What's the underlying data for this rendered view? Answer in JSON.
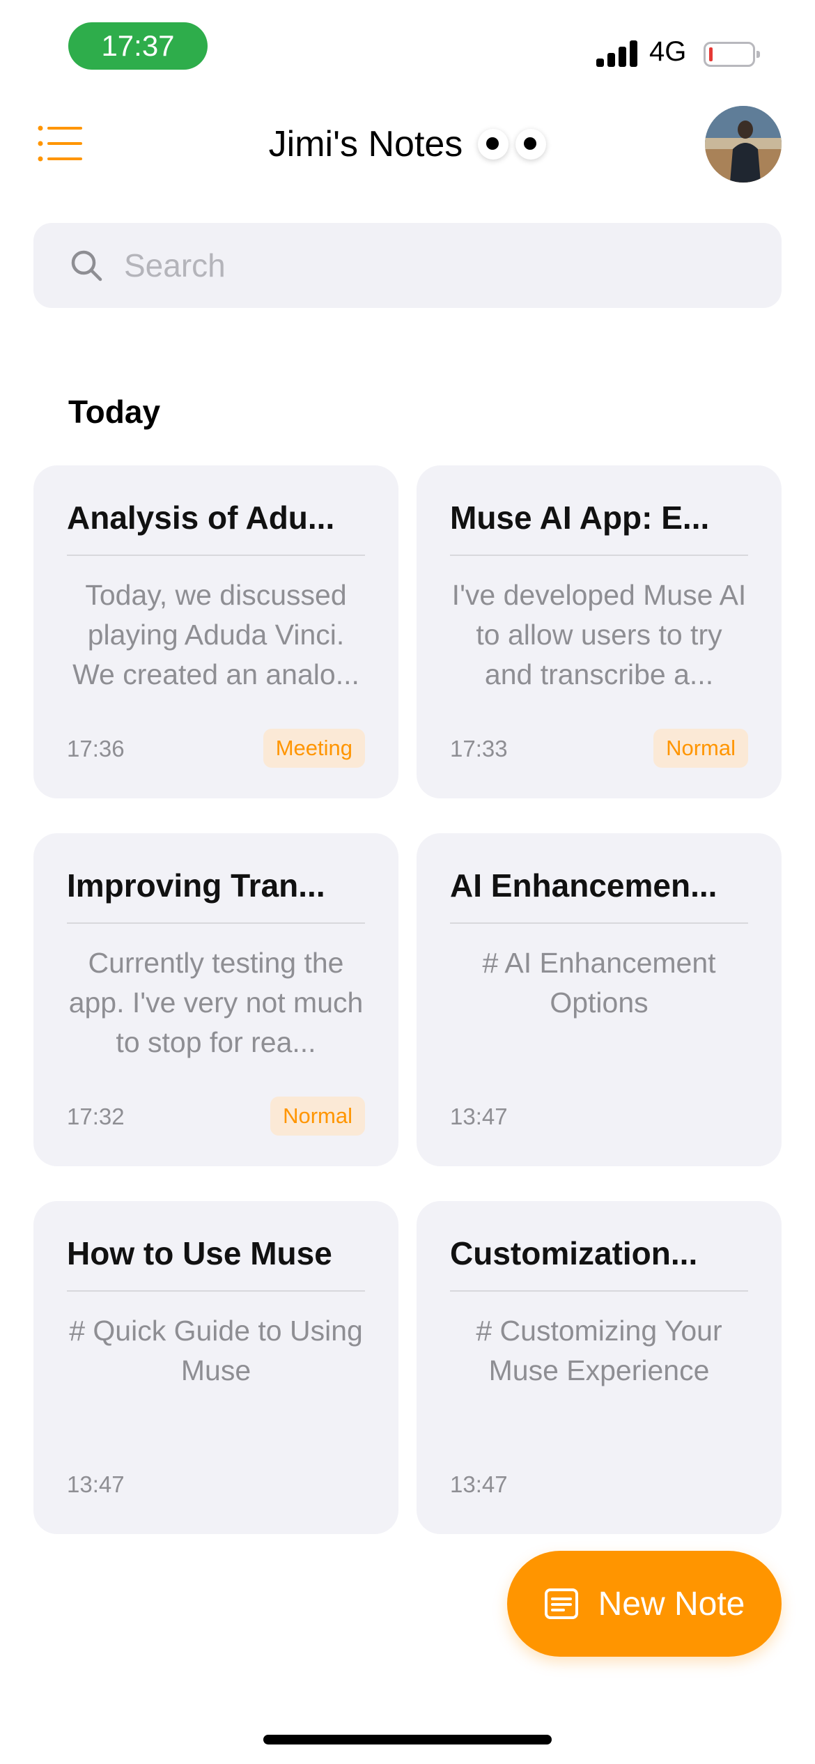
{
  "status_bar": {
    "time": "17:37",
    "network": "4G"
  },
  "header": {
    "title": "Jimi's Notes",
    "menu_icon": "list-icon",
    "accent_color": "#ff9500"
  },
  "search": {
    "placeholder": "Search",
    "value": ""
  },
  "section": {
    "label": "Today"
  },
  "notes": [
    {
      "title": "Analysis of Adu...",
      "preview": "Today, we discussed playing Aduda Vinci. We created an analo...",
      "time": "17:36",
      "tag": "Meeting"
    },
    {
      "title": "Muse AI App: E...",
      "preview": "I've developed Muse AI to allow users to try and transcribe a...",
      "time": "17:33",
      "tag": "Normal"
    },
    {
      "title": "Improving Tran...",
      "preview": "Currently testing the app. I've very not much to stop for rea...",
      "time": "17:32",
      "tag": "Normal"
    },
    {
      "title": "AI Enhancemen...",
      "preview": "# AI Enhancement Options",
      "time": "13:47",
      "tag": ""
    },
    {
      "title": "How to Use Muse",
      "preview": "# Quick Guide to Using Muse",
      "time": "13:47",
      "tag": ""
    },
    {
      "title": "Customization...",
      "preview": "# Customizing Your Muse Experience",
      "time": "13:47",
      "tag": ""
    }
  ],
  "fab": {
    "label": "New Note",
    "icon": "note-icon"
  }
}
